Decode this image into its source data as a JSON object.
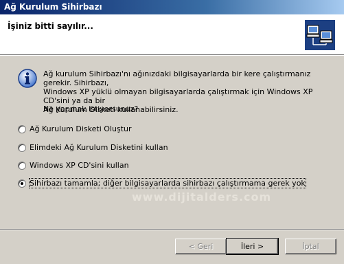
{
  "window": {
    "title": "Ağ Kurulum Sihirbazı"
  },
  "header": {
    "title": "İşiniz bitti sayılır...",
    "icon": "network-computers-icon"
  },
  "info": {
    "icon": "info-icon",
    "lines": [
      "Ağ kurulum Sihirbazı'nı ağınızdaki bilgisayarlarda bir kere çalıştırmanız gerekir. Sihirbazı,",
      "Windows XP yüklü olmayan bilgisayarlarda çalıştırmak için Windows XP CD'sini ya da bir",
      "Ağ Kurulum Disketi kullanabilirsiniz."
    ]
  },
  "question": "Ne yapmak istiyorsunuz?",
  "options": [
    {
      "label": "Ağ Kurulum Disketi Oluştur",
      "checked": false
    },
    {
      "label": "Elimdeki Ağ Kurulum Disketini kullan",
      "checked": false
    },
    {
      "label": "Windows XP CD'sini kullan",
      "checked": false
    },
    {
      "label": "Sihirbazı tamamla; diğer bilgisayarlarda sihirbazı çalıştırmama gerek yok",
      "checked": true
    }
  ],
  "watermark": "www.dijitalders.com",
  "buttons": {
    "back": "< Geri",
    "next": "İleri >",
    "cancel": "İptal"
  }
}
